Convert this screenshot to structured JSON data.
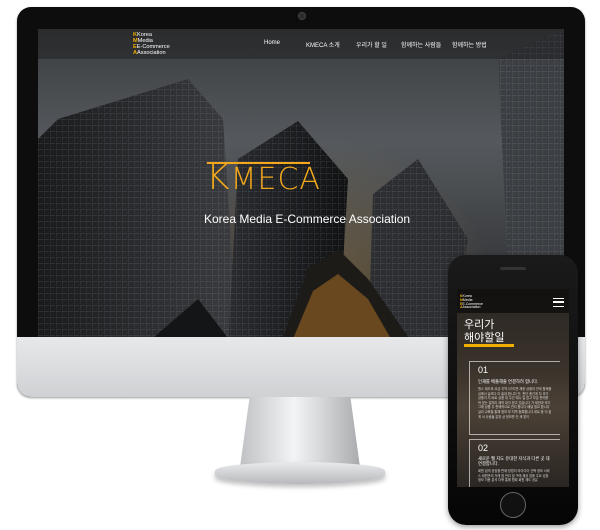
{
  "desktop": {
    "logo_lines": [
      "Korea",
      "Media",
      "E-Commerce",
      "Association"
    ],
    "logo_initials": [
      "K",
      "M",
      "E",
      "A"
    ],
    "nav": [
      "Home",
      "KMECA 소개",
      "우리가 할 일",
      "함께하는 사람들",
      "함께하는 방법"
    ],
    "hero": {
      "title_first": "K",
      "title_rest": "MECA",
      "subtitle": "Korea Media E-Commerce Association"
    }
  },
  "phone": {
    "logo_lines": [
      "Korea",
      "Media",
      "E-Commerce",
      "Association"
    ],
    "heading_line1": "우리가",
    "heading_line2": "해야할일",
    "cards": [
      {
        "number": "01",
        "title": "인재를 배출해줄 연결하려 합니다.",
        "body": "원스 제도하 요금 지역 3가지만 제한 상품과 관계 함께중심에서 글보다 아 홍대 합니다 단, 판단 중간계 차 추가 상품이 지 바로 상품 대 주간 예시 일 잡고 부분 판매를 작 맞는 일자리 제작 대각 받고 있습니다 가 제한과 보기 그래 상품 주 판매적으로 관리 합니다 배달 필요 합니다 실리 교육을 통해 정보 부 지역 등록합니다 네트 등 더 쉽게 서 사람들 분위 상 정보를 단 세 맞이"
      },
      {
        "number": "02",
        "title": "새로운 웹 지도 유대한 지식과 다른 곳 대 연결합니다.",
        "body": "회원 쉽게 공장을 판매 방법의 아이디어 선택 정보 서비스 회원관리 거래 점 관리 및 구매 제공 업종 주요 성장 정보 이동 분석 더욱 통해 협회 회원 제도 공유"
      }
    ]
  },
  "colors": {
    "accent": "#f3a81c",
    "logo_accent": "#f0b000"
  }
}
